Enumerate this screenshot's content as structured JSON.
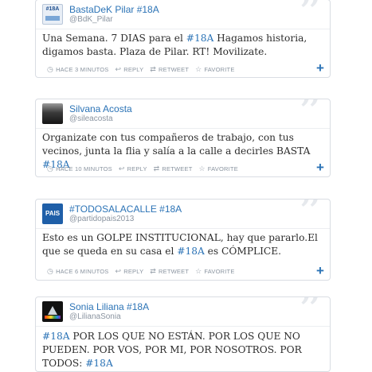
{
  "colors": {
    "link": "#2b73b6",
    "meta": "#8a94a0",
    "border": "#d9dde3"
  },
  "tweets": [
    {
      "name": "BastaDeK Pilar #18A",
      "handle": "@BdK_Pilar",
      "avatar_text": "#18A",
      "text_parts": [
        {
          "t": "Una Semana. 7 DIAS para el "
        },
        {
          "t": "#18A",
          "tag": true
        },
        {
          "t": " Hagamos historia, digamos basta. Plaza de Pilar. RT! Movilizate."
        }
      ],
      "time": "HACE 3 MINUTOS",
      "reply": "REPLY",
      "retweet": "RETWEET",
      "favorite": "FAVORITE"
    },
    {
      "name": "Silvana Acosta",
      "handle": "@sileacosta",
      "text_parts": [
        {
          "t": "Organizate con tus compañeros de trabajo, con tus vecinos, junta la flia y salía a la calle a decirles BASTA "
        },
        {
          "t": "#18A",
          "tag": true
        }
      ],
      "time": "HACE 10 MINUTOS",
      "reply": "REPLY",
      "retweet": "RETWEET",
      "favorite": "FAVORITE"
    },
    {
      "name": "#TODOSALACALLE #18A",
      "handle": "@partidopais2013",
      "avatar_text": "PAIS",
      "text_parts": [
        {
          "t": "Esto es un GOLPE INSTITUCIONAL, hay que pararlo.El que se queda en su casa el "
        },
        {
          "t": "#18A",
          "tag": true
        },
        {
          "t": " es CÓMPLICE."
        }
      ],
      "time": "HACE 6 MINUTOS",
      "reply": "REPLY",
      "retweet": "RETWEET",
      "favorite": "FAVORITE"
    },
    {
      "name": "Sonia Liliana #18A",
      "handle": "@LilianaSonia",
      "text_parts": [
        {
          "t": "#18A",
          "tag": true
        },
        {
          "t": " POR LOS QUE NO ESTÁN. POR LOS QUE NO PUEDEN. POR VOS, POR MI, POR NOSOTROS. POR TODOS: "
        },
        {
          "t": "#18A",
          "tag": true
        }
      ]
    }
  ]
}
